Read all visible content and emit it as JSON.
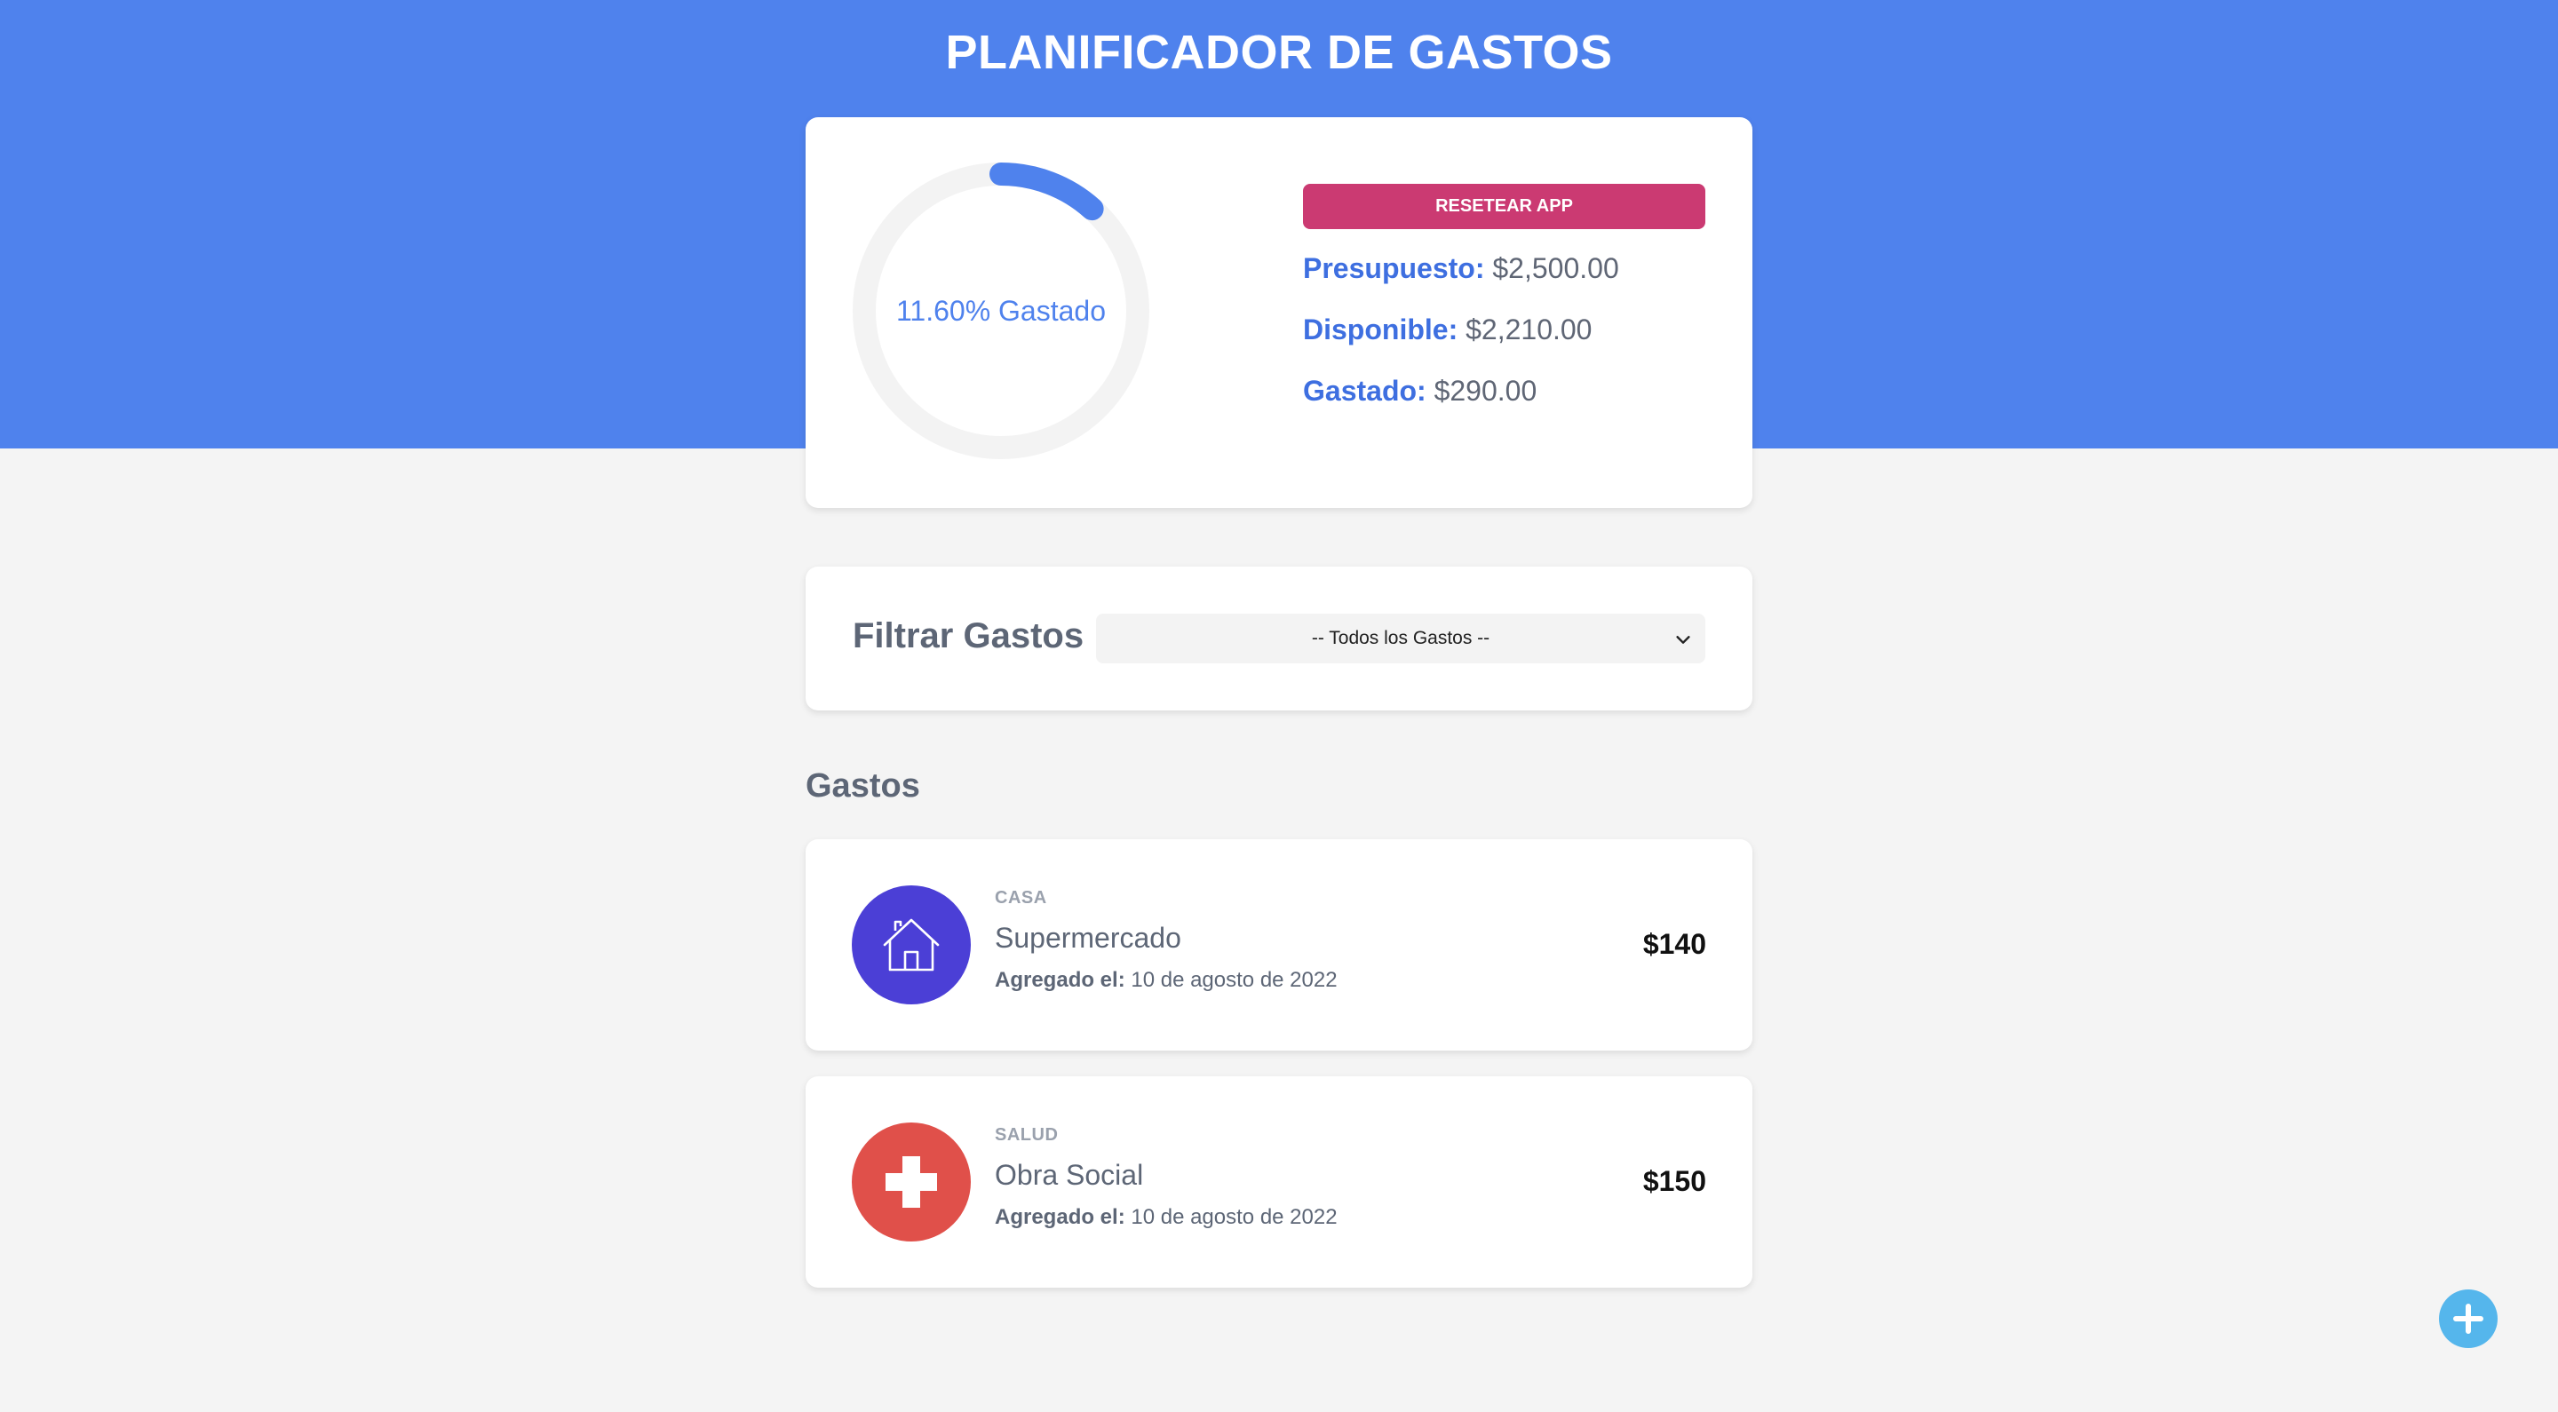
{
  "header": {
    "title": "PLANIFICADOR DE GASTOS"
  },
  "budget": {
    "percent_label": "11.60% Gastado",
    "percent_spent": 11.6,
    "reset_label": "RESETEAR APP",
    "presupuesto_label": "Presupuesto:",
    "presupuesto_value": "$2,500.00",
    "disponible_label": "Disponible:",
    "disponible_value": "$2,210.00",
    "gastado_label": "Gastado:",
    "gastado_value": "$290.00"
  },
  "filter": {
    "label": "Filtrar Gastos",
    "selected": "-- Todos los Gastos --"
  },
  "expenses": {
    "title": "Gastos",
    "items": [
      {
        "category": "CASA",
        "name": "Supermercado",
        "date_label": "Agregado el:",
        "date": "10 de agosto de 2022",
        "amount": "$140",
        "icon": "house-icon",
        "icon_color": "#4b3fd6"
      },
      {
        "category": "SALUD",
        "name": "Obra Social",
        "date_label": "Agregado el:",
        "date": "10 de agosto de 2022",
        "amount": "$150",
        "icon": "health-cross-icon",
        "icon_color": "#e0504a"
      }
    ]
  },
  "colors": {
    "header": "#4f82ed",
    "accent": "#3e6fe0",
    "reset": "#cb3a72",
    "fab": "#55b6ec"
  }
}
